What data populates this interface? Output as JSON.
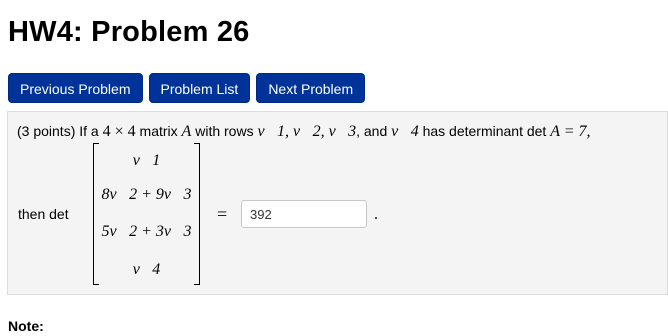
{
  "page": {
    "title": "HW4: Problem 26"
  },
  "nav": {
    "previous_label": "Previous Problem",
    "list_label": "Problem List",
    "next_label": "Next Problem"
  },
  "problem": {
    "points": "(3 points)",
    "intro": "If a",
    "size": "4 × 4",
    "matrix_word": "matrix",
    "matrix_var": "A",
    "with_rows": "with rows",
    "rows_list": "v⃗1, v⃗2, v⃗3",
    "and_word": ", and",
    "last_row": "v⃗4",
    "has_det": "has determinant det",
    "det_eq": "A = 7,",
    "then_label": "then  det",
    "matrix_rows": [
      "v⃗1",
      "8v⃗2 + 9v⃗3",
      "5v⃗2 + 3v⃗3",
      "v⃗4"
    ],
    "equals": "=",
    "answer_value": "392",
    "period": "."
  },
  "note": {
    "label": "Note:"
  }
}
